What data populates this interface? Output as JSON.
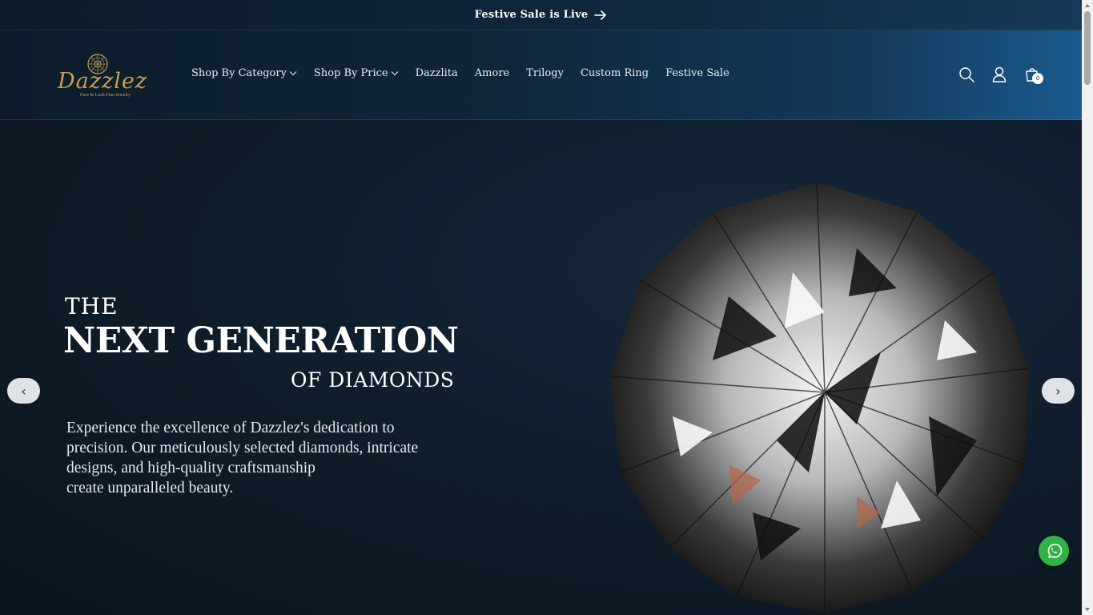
{
  "announcement": {
    "text": "Festive Sale is Live",
    "icon": "arrow-right-icon"
  },
  "header": {
    "logo": {
      "word": "Dazzlez",
      "tagline": "Pure & Lush Fine Jewelry",
      "color": "#c8a04c"
    },
    "nav": [
      {
        "label": "Shop By Category",
        "dropdown": true
      },
      {
        "label": "Shop By Price",
        "dropdown": true
      },
      {
        "label": "Dazzlita"
      },
      {
        "label": "Amore"
      },
      {
        "label": "Trilogy"
      },
      {
        "label": "Custom Ring"
      },
      {
        "label": "Festive Sale"
      }
    ],
    "icons": [
      "search-icon",
      "account-icon",
      "cart-icon"
    ],
    "cart_count": "0"
  },
  "hero": {
    "line1": "THE",
    "line2": "NEXT GENERATION",
    "line3": "OF DIAMONDS",
    "description": [
      "Experience the excellence of Dazzlez's dedication to",
      "precision. Our meticulously selected diamonds, intricate",
      "designs, and high-quality craftsmanship",
      "create unparalleled beauty."
    ],
    "prev_label": "‹",
    "next_label": "›"
  },
  "whatsapp": {
    "icon": "whatsapp-icon",
    "color": "#2fb344"
  }
}
